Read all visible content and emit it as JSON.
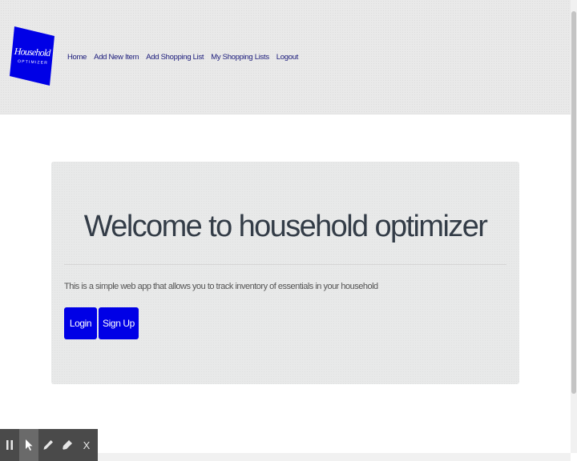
{
  "brand": {
    "logo_main": "Household",
    "logo_sub": "OPTIMIZER",
    "color": "#0000e6"
  },
  "nav": {
    "items": [
      {
        "label": "Home"
      },
      {
        "label": "Add New Item"
      },
      {
        "label": "Add Shopping List"
      },
      {
        "label": "My Shopping Lists"
      },
      {
        "label": "Logout"
      }
    ]
  },
  "jumbotron": {
    "title": "Welcome to household optimizer",
    "description": "This is a simple web app that allows you to track inventory of essentials in your household",
    "buttons": {
      "login": "Login",
      "signup": "Sign Up"
    },
    "button_color": "#0000e6"
  },
  "toolbar": {
    "tools": [
      {
        "icon": "pause-icon"
      },
      {
        "icon": "cursor-icon"
      },
      {
        "icon": "pen-icon"
      },
      {
        "icon": "highlighter-icon"
      },
      {
        "icon": "close-icon",
        "label": "X"
      }
    ]
  }
}
